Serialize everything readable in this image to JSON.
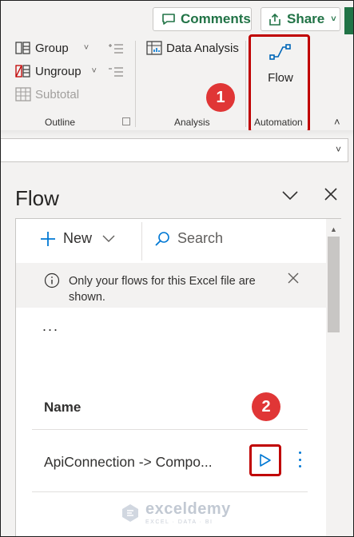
{
  "toolbar": {
    "comments_label": "Comments",
    "share_label": "Share"
  },
  "ribbon": {
    "outline": {
      "group_label": "Group",
      "ungroup_label": "Ungroup",
      "subtotal_label": "Subtotal",
      "section_label": "Outline"
    },
    "analysis": {
      "data_analysis_label": "Data Analysis",
      "section_label": "Analysis"
    },
    "automation": {
      "flow_label": "Flow",
      "section_label": "Automation"
    }
  },
  "annotations": {
    "step1": "1",
    "step2": "2",
    "highlight_color": "#c00000",
    "badge_color": "#e03636"
  },
  "pane": {
    "title": "Flow",
    "new_label": "New",
    "search_label": "Search",
    "info_message": "Only your flows for this Excel file are shown.",
    "more_dots": "...",
    "column_header": "Name",
    "flows": [
      {
        "name": "ApiConnection -> Compo..."
      }
    ]
  },
  "watermark": {
    "name": "exceldemy",
    "tagline": "EXCEL · DATA · BI"
  },
  "colors": {
    "excel_green": "#217346",
    "accent_blue": "#0078d4",
    "ribbon_bg": "#f3f2f1"
  }
}
